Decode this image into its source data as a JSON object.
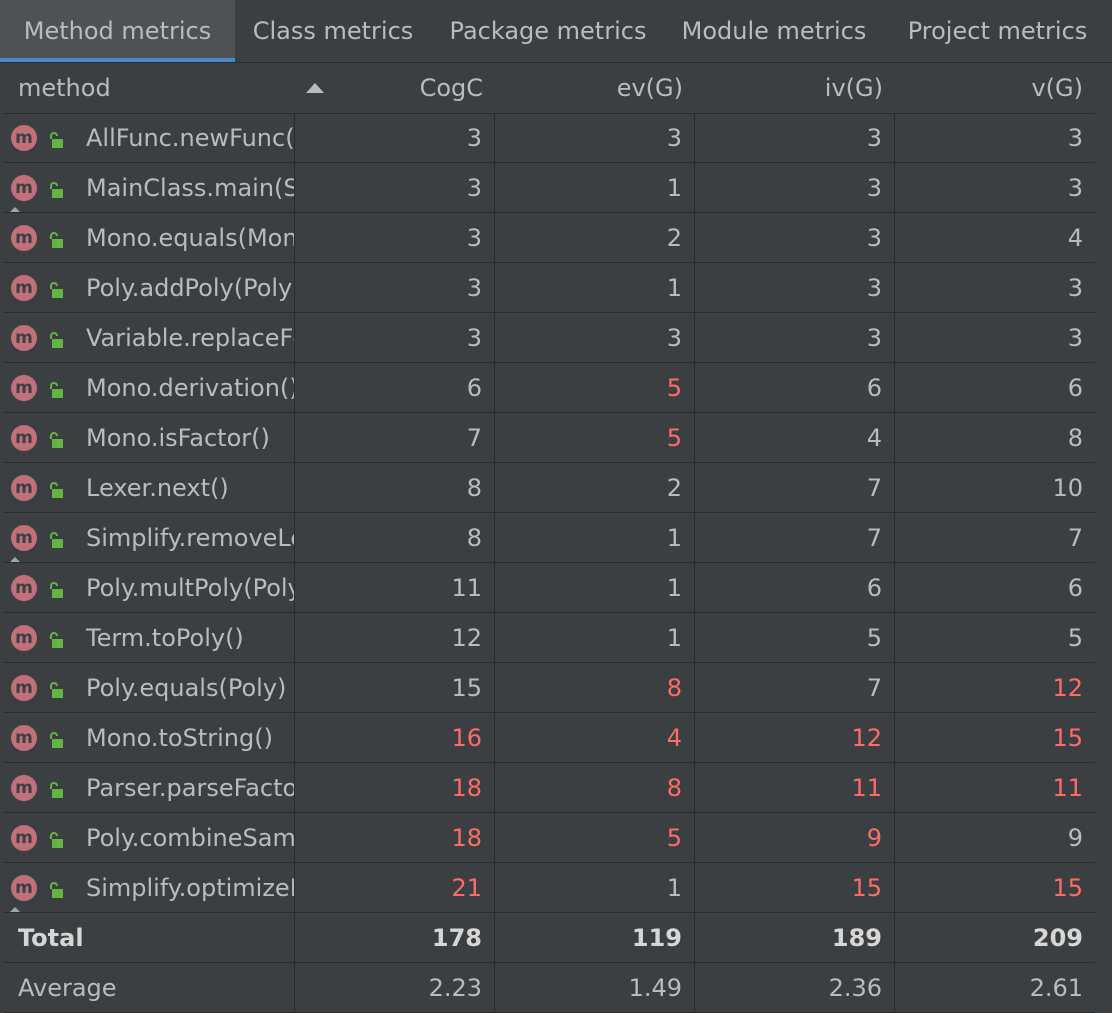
{
  "tabs": [
    {
      "label": "Method metrics",
      "active": true
    },
    {
      "label": "Class metrics",
      "active": false
    },
    {
      "label": "Package metrics",
      "active": false
    },
    {
      "label": "Module metrics",
      "active": false
    },
    {
      "label": "Project metrics",
      "active": false
    }
  ],
  "table": {
    "columns": [
      "method",
      "CogC",
      "ev(G)",
      "iv(G)",
      "v(G)"
    ],
    "sort": {
      "column": "method",
      "direction": "ascending"
    },
    "highlight_color": "#ff6b68",
    "rows": [
      {
        "method": "AllFunc.newFunc(S",
        "cogc": "3",
        "evg": "3",
        "ivg": "3",
        "vg": "3"
      },
      {
        "method": "MainClass.main(St",
        "cogc": "3",
        "evg": "1",
        "ivg": "3",
        "vg": "3"
      },
      {
        "method": "Mono.equals(Mon",
        "cogc": "3",
        "evg": "2",
        "ivg": "3",
        "vg": "4"
      },
      {
        "method": "Poly.addPoly(Poly)",
        "cogc": "3",
        "evg": "1",
        "ivg": "3",
        "vg": "3"
      },
      {
        "method": "Variable.replaceFo",
        "cogc": "3",
        "evg": "3",
        "ivg": "3",
        "vg": "3"
      },
      {
        "method": "Mono.derivation()",
        "cogc": "6",
        "evg": "5",
        "ivg": "6",
        "vg": "6"
      },
      {
        "method": "Mono.isFactor()",
        "cogc": "7",
        "evg": "5",
        "ivg": "4",
        "vg": "8"
      },
      {
        "method": "Lexer.next()",
        "cogc": "8",
        "evg": "2",
        "ivg": "7",
        "vg": "10"
      },
      {
        "method": "Simplify.removeLe",
        "cogc": "8",
        "evg": "1",
        "ivg": "7",
        "vg": "7"
      },
      {
        "method": "Poly.multPoly(Poly",
        "cogc": "11",
        "evg": "1",
        "ivg": "6",
        "vg": "6"
      },
      {
        "method": "Term.toPoly()",
        "cogc": "12",
        "evg": "1",
        "ivg": "5",
        "vg": "5"
      },
      {
        "method": "Poly.equals(Poly)",
        "cogc": "15",
        "evg": "8",
        "ivg": "7",
        "vg": "12"
      },
      {
        "method": "Mono.toString()",
        "cogc": "16",
        "evg": "4",
        "ivg": "12",
        "vg": "15"
      },
      {
        "method": "Parser.parseFactor",
        "cogc": "18",
        "evg": "8",
        "ivg": "11",
        "vg": "11"
      },
      {
        "method": "Poly.combineSame",
        "cogc": "18",
        "evg": "5",
        "ivg": "9",
        "vg": "9"
      },
      {
        "method": "Simplify.optimizeM",
        "cogc": "21",
        "evg": "1",
        "ivg": "15",
        "vg": "15"
      }
    ],
    "red_cells": [
      {
        "row": 5,
        "cols": [
          "evg"
        ]
      },
      {
        "row": 6,
        "cols": [
          "evg"
        ]
      },
      {
        "row": 11,
        "cols": [
          "evg",
          "vg"
        ]
      },
      {
        "row": 12,
        "cols": [
          "cogc",
          "evg",
          "ivg",
          "vg"
        ]
      },
      {
        "row": 13,
        "cols": [
          "cogc",
          "evg",
          "ivg",
          "vg"
        ]
      },
      {
        "row": 14,
        "cols": [
          "cogc",
          "evg",
          "ivg"
        ]
      },
      {
        "row": 15,
        "cols": [
          "cogc",
          "ivg",
          "vg"
        ]
      }
    ],
    "static_marker_rows": [
      1,
      8,
      15
    ],
    "total": {
      "label": "Total",
      "cogc": "178",
      "evg": "119",
      "ivg": "189",
      "vg": "209"
    },
    "average": {
      "label": "Average",
      "cogc": "2.23",
      "evg": "1.49",
      "ivg": "2.36",
      "vg": "2.61"
    }
  },
  "icons": {
    "method": "method-m-icon",
    "access": "public-lock-icon",
    "static": "static-marker-icon"
  }
}
